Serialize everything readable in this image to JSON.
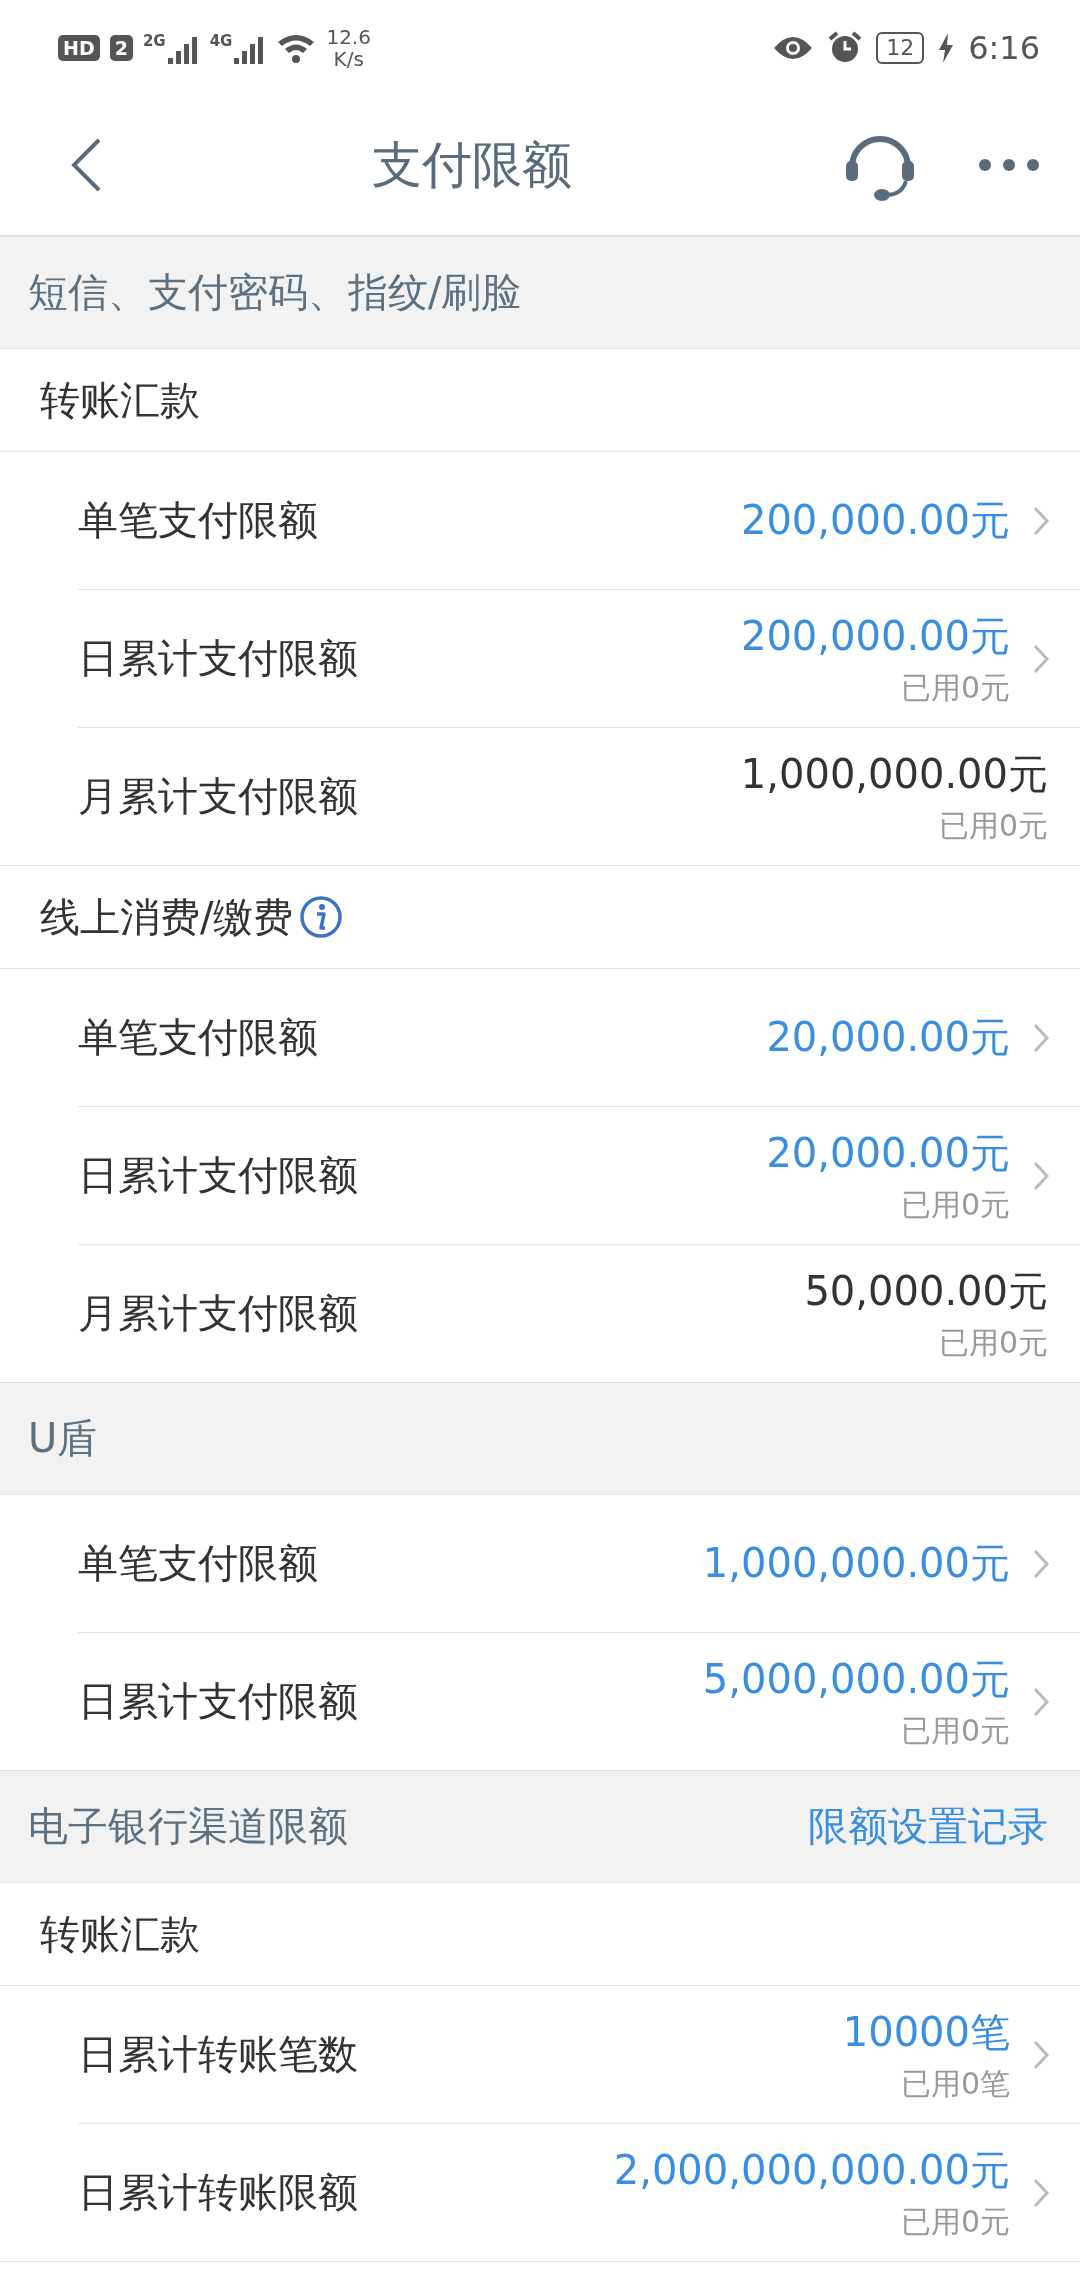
{
  "status_bar": {
    "hd": "HD",
    "sim": "2",
    "network_1": "2G",
    "network_2": "4G",
    "speed": "12.6",
    "speed_unit": "K/s",
    "battery": "12",
    "time": "6:16"
  },
  "nav": {
    "title": "支付限额"
  },
  "sections": [
    {
      "title": "短信、支付密码、指纹/刷脸",
      "items": [
        {
          "kind": "group",
          "label": "转账汇款",
          "info": false
        },
        {
          "kind": "row",
          "label": "单笔支付限额",
          "value": "200,000.00元",
          "editable": true
        },
        {
          "kind": "row",
          "label": "日累计支付限额",
          "value": "200,000.00元",
          "used": "已用0元",
          "editable": true
        },
        {
          "kind": "row",
          "label": "月累计支付限额",
          "value": "1,000,000.00元",
          "used": "已用0元",
          "editable": false
        },
        {
          "kind": "group",
          "label": "线上消费/缴费",
          "info": true
        },
        {
          "kind": "row",
          "label": "单笔支付限额",
          "value": "20,000.00元",
          "editable": true
        },
        {
          "kind": "row",
          "label": "日累计支付限额",
          "value": "20,000.00元",
          "used": "已用0元",
          "editable": true
        },
        {
          "kind": "row",
          "label": "月累计支付限额",
          "value": "50,000.00元",
          "used": "已用0元",
          "editable": false
        }
      ]
    },
    {
      "title": "U盾",
      "items": [
        {
          "kind": "row",
          "label": "单笔支付限额",
          "value": "1,000,000.00元",
          "editable": true
        },
        {
          "kind": "row",
          "label": "日累计支付限额",
          "value": "5,000,000.00元",
          "used": "已用0元",
          "editable": true
        }
      ]
    },
    {
      "title": "电子银行渠道限额",
      "action": "限额设置记录",
      "items": [
        {
          "kind": "group",
          "label": "转账汇款",
          "info": false
        },
        {
          "kind": "row",
          "label": "日累计转账笔数",
          "value": "10000笔",
          "used": "已用0笔",
          "editable": true
        },
        {
          "kind": "row",
          "label": "日累计转账限额",
          "value": "2,000,000,000.00元",
          "used": "已用0元",
          "editable": true
        }
      ]
    }
  ]
}
